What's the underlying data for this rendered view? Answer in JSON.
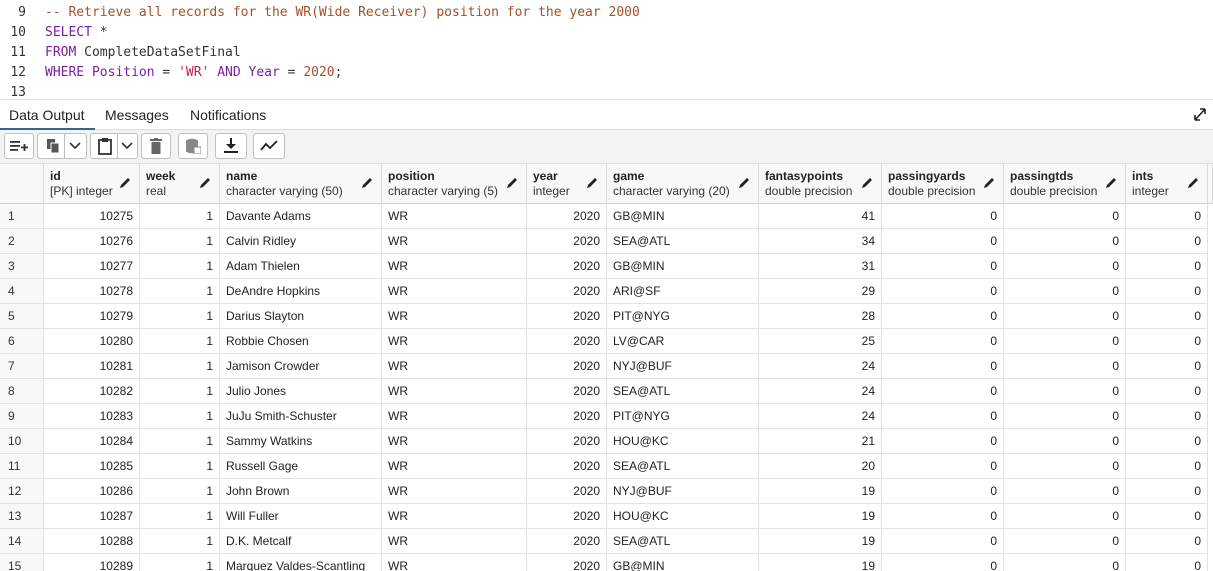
{
  "editor": {
    "lines": [
      {
        "num": "9",
        "tokens": [
          {
            "c": "cm",
            "t": "-- Retrieve all records for the WR(Wide Receiver) position for the year 2000"
          }
        ]
      },
      {
        "num": "10",
        "tokens": [
          {
            "c": "kw",
            "t": "SELECT"
          },
          {
            "c": "plain",
            "t": " *"
          }
        ]
      },
      {
        "num": "11",
        "tokens": [
          {
            "c": "kw",
            "t": "FROM"
          },
          {
            "c": "plain",
            "t": " CompleteDataSetFinal"
          }
        ]
      },
      {
        "num": "12",
        "tokens": [
          {
            "c": "kw",
            "t": "WHERE"
          },
          {
            "c": "kw",
            "t": " Position"
          },
          {
            "c": "plain",
            "t": " = "
          },
          {
            "c": "str",
            "t": "'WR'"
          },
          {
            "c": "kw",
            "t": " AND"
          },
          {
            "c": "kw",
            "t": " Year"
          },
          {
            "c": "plain",
            "t": " = "
          },
          {
            "c": "num",
            "t": "2020"
          },
          {
            "c": "plain",
            "t": ";"
          }
        ]
      },
      {
        "num": "13",
        "tokens": []
      }
    ]
  },
  "tabs": {
    "data_output": "Data Output",
    "messages": "Messages",
    "notifications": "Notifications"
  },
  "toolbar": {
    "icons": [
      "add-row-icon",
      "copy-icon",
      "chevron-down-icon",
      "paste-icon",
      "chevron-down-icon",
      "delete-icon",
      "save-data-icon",
      "download-icon",
      "graph-icon"
    ]
  },
  "grid": {
    "columns": [
      {
        "name": "id",
        "type": "[PK] integer"
      },
      {
        "name": "week",
        "type": "real"
      },
      {
        "name": "name",
        "type": "character varying (50)"
      },
      {
        "name": "position",
        "type": "character varying (5)"
      },
      {
        "name": "year",
        "type": "integer"
      },
      {
        "name": "game",
        "type": "character varying (20)"
      },
      {
        "name": "fantasypoints",
        "type": "double precision"
      },
      {
        "name": "passingyards",
        "type": "double precision"
      },
      {
        "name": "passingtds",
        "type": "double precision"
      },
      {
        "name": "ints",
        "type": "integer"
      }
    ],
    "rows": [
      [
        "1",
        "10275",
        "1",
        "Davante Adams",
        "WR",
        "2020",
        "GB@MIN",
        "41",
        "0",
        "0",
        "0"
      ],
      [
        "2",
        "10276",
        "1",
        "Calvin Ridley",
        "WR",
        "2020",
        "SEA@ATL",
        "34",
        "0",
        "0",
        "0"
      ],
      [
        "3",
        "10277",
        "1",
        "Adam Thielen",
        "WR",
        "2020",
        "GB@MIN",
        "31",
        "0",
        "0",
        "0"
      ],
      [
        "4",
        "10278",
        "1",
        "DeAndre Hopkins",
        "WR",
        "2020",
        "ARI@SF",
        "29",
        "0",
        "0",
        "0"
      ],
      [
        "5",
        "10279",
        "1",
        "Darius Slayton",
        "WR",
        "2020",
        "PIT@NYG",
        "28",
        "0",
        "0",
        "0"
      ],
      [
        "6",
        "10280",
        "1",
        "Robbie Chosen",
        "WR",
        "2020",
        "LV@CAR",
        "25",
        "0",
        "0",
        "0"
      ],
      [
        "7",
        "10281",
        "1",
        "Jamison Crowder",
        "WR",
        "2020",
        "NYJ@BUF",
        "24",
        "0",
        "0",
        "0"
      ],
      [
        "8",
        "10282",
        "1",
        "Julio Jones",
        "WR",
        "2020",
        "SEA@ATL",
        "24",
        "0",
        "0",
        "0"
      ],
      [
        "9",
        "10283",
        "1",
        "JuJu Smith-Schuster",
        "WR",
        "2020",
        "PIT@NYG",
        "24",
        "0",
        "0",
        "0"
      ],
      [
        "10",
        "10284",
        "1",
        "Sammy Watkins",
        "WR",
        "2020",
        "HOU@KC",
        "21",
        "0",
        "0",
        "0"
      ],
      [
        "11",
        "10285",
        "1",
        "Russell Gage",
        "WR",
        "2020",
        "SEA@ATL",
        "20",
        "0",
        "0",
        "0"
      ],
      [
        "12",
        "10286",
        "1",
        "John Brown",
        "WR",
        "2020",
        "NYJ@BUF",
        "19",
        "0",
        "0",
        "0"
      ],
      [
        "13",
        "10287",
        "1",
        "Will Fuller",
        "WR",
        "2020",
        "HOU@KC",
        "19",
        "0",
        "0",
        "0"
      ],
      [
        "14",
        "10288",
        "1",
        "D.K. Metcalf",
        "WR",
        "2020",
        "SEA@ATL",
        "19",
        "0",
        "0",
        "0"
      ],
      [
        "15",
        "10289",
        "1",
        "Marquez Valdes-Scantling",
        "WR",
        "2020",
        "GB@MIN",
        "19",
        "0",
        "0",
        "0"
      ]
    ]
  }
}
